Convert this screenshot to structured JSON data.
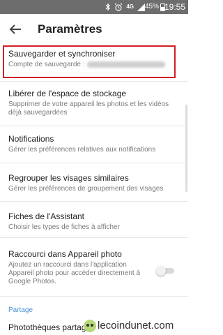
{
  "status_bar": {
    "icons": [
      "bluetooth-icon",
      "alarm-icon",
      "network-4g-icon",
      "signal-icon"
    ],
    "network_label": "4G",
    "battery": "45%",
    "time": "19:55"
  },
  "header": {
    "title": "Paramètres"
  },
  "settings": [
    {
      "title": "Sauvegarder et synchroniser",
      "subtitle": "Compte de sauvegarde :"
    },
    {
      "title": "Libérer de l'espace de stockage",
      "subtitle": "Supprimer de votre appareil les photos et les vidéos déjà sauvegardées"
    },
    {
      "title": "Notifications",
      "subtitle": "Gérer les préférences relatives aux notifications"
    },
    {
      "title": "Regrouper les visages similaires",
      "subtitle": "Gérer les préférences de groupement des visages"
    },
    {
      "title": "Fiches de l'Assistant",
      "subtitle": "Choisir les types de fiches à afficher"
    },
    {
      "title": "Raccourci dans Appareil photo",
      "subtitle": "Ajoutez un raccourci dans l'application Appareil photo pour accéder directement à Google Photos.",
      "toggle": false
    }
  ],
  "section_header": "Partage",
  "partial_item": "Photothèques partag",
  "watermark": "lecoindunet.com",
  "colors": {
    "highlight": "#d22128",
    "section": "#4a8fd8",
    "status_bar": "#6d6d6d"
  }
}
